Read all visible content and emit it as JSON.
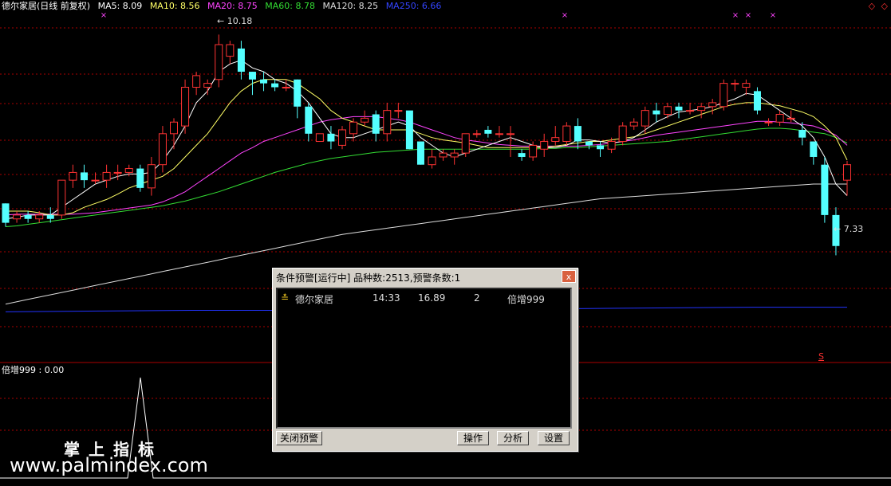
{
  "legend": {
    "stock": "德尔家居(日线 前复权)",
    "ma5": "MA5: 8.09",
    "ma10": "MA10: 8.56",
    "ma20": "MA20: 8.75",
    "ma60": "MA60: 8.78",
    "ma120": "MA120: 8.25",
    "ma250": "MA250: 6.66"
  },
  "colors": {
    "up": "#ff3333",
    "down": "#54ffff",
    "ma5": "#ffffff",
    "ma10": "#ffff66",
    "ma20": "#ff44ff",
    "ma60": "#33dd33",
    "ma120": "#dddddd",
    "ma250": "#2233ff",
    "grid": "#aa0000"
  },
  "top_right": "◇ ◇",
  "high_label": "10.18",
  "low_label": "7.33",
  "signal_mark": "S",
  "sub_legend": "倍增999 : 0.00",
  "dialog": {
    "title": "条件预警[运行中] 品种数:2513,预警条数:1",
    "close": "x",
    "row": {
      "icon": "≛",
      "name": "德尔家居",
      "time": "14:33",
      "price": "16.89",
      "count": "2",
      "formula": "倍增999"
    },
    "btn_close_alert": "关闭预警",
    "btn_operate": "操作",
    "btn_analyze": "分析",
    "btn_settings": "设置"
  },
  "watermark_cn": "掌上指标",
  "watermark_url": "www.palmindex.com",
  "chart_data": {
    "type": "candlestick",
    "ylim": [
      6.1,
      10.4
    ],
    "candles": [
      [
        8.0,
        7.75,
        7.7,
        8.0
      ],
      [
        7.8,
        7.85,
        7.75,
        7.9
      ],
      [
        7.85,
        7.8,
        7.75,
        7.9
      ],
      [
        7.8,
        7.85,
        7.75,
        7.9
      ],
      [
        7.85,
        7.8,
        7.75,
        7.95
      ],
      [
        7.85,
        8.3,
        7.8,
        8.3
      ],
      [
        8.3,
        8.4,
        8.2,
        8.5
      ],
      [
        8.4,
        8.3,
        8.2,
        8.5
      ],
      [
        8.3,
        8.3,
        8.25,
        8.4
      ],
      [
        8.3,
        8.4,
        8.2,
        8.5
      ],
      [
        8.4,
        8.4,
        8.3,
        8.5
      ],
      [
        8.4,
        8.45,
        8.35,
        8.5
      ],
      [
        8.45,
        8.2,
        8.15,
        8.5
      ],
      [
        8.2,
        8.5,
        8.1,
        8.6
      ],
      [
        8.5,
        8.9,
        8.4,
        9.0
      ],
      [
        8.9,
        9.05,
        8.7,
        9.1
      ],
      [
        9.0,
        9.5,
        8.9,
        9.6
      ],
      [
        9.5,
        9.65,
        9.4,
        9.7
      ],
      [
        9.5,
        9.55,
        9.4,
        9.6
      ],
      [
        9.6,
        10.05,
        9.5,
        10.18
      ],
      [
        9.9,
        10.05,
        9.8,
        10.1
      ],
      [
        10.0,
        9.7,
        9.6,
        10.1
      ],
      [
        9.7,
        9.6,
        9.4,
        9.7
      ],
      [
        9.6,
        9.55,
        9.45,
        9.7
      ],
      [
        9.55,
        9.5,
        9.45,
        9.6
      ],
      [
        9.5,
        9.5,
        9.45,
        9.6
      ],
      [
        9.6,
        9.25,
        9.1,
        9.6
      ],
      [
        9.25,
        8.9,
        8.8,
        9.3
      ],
      [
        8.8,
        8.9,
        8.8,
        8.9
      ],
      [
        8.9,
        8.8,
        8.7,
        9.0
      ],
      [
        8.75,
        8.95,
        8.7,
        9.0
      ],
      [
        8.9,
        9.05,
        8.8,
        9.1
      ],
      [
        9.05,
        9.1,
        9.0,
        9.2
      ],
      [
        9.15,
        8.9,
        8.8,
        9.2
      ],
      [
        8.9,
        9.2,
        8.8,
        9.3
      ],
      [
        9.2,
        9.2,
        9.1,
        9.3
      ],
      [
        9.2,
        8.7,
        8.7,
        9.0
      ],
      [
        8.8,
        8.5,
        8.5,
        8.8
      ],
      [
        8.5,
        8.6,
        8.45,
        8.7
      ],
      [
        8.6,
        8.65,
        8.55,
        8.7
      ],
      [
        8.6,
        8.65,
        8.5,
        8.7
      ],
      [
        8.65,
        8.9,
        8.6,
        8.9
      ],
      [
        8.9,
        8.9,
        8.85,
        8.95
      ],
      [
        8.95,
        8.9,
        8.85,
        9.0
      ],
      [
        8.9,
        8.9,
        8.85,
        9.0
      ],
      [
        8.9,
        8.9,
        8.6,
        9.0
      ],
      [
        8.65,
        8.6,
        8.55,
        8.7
      ],
      [
        8.6,
        8.75,
        8.55,
        8.8
      ],
      [
        8.7,
        8.8,
        8.6,
        8.9
      ],
      [
        8.8,
        8.85,
        8.75,
        9.0
      ],
      [
        8.8,
        9.0,
        8.75,
        9.05
      ],
      [
        9.0,
        8.8,
        8.7,
        9.1
      ],
      [
        8.8,
        8.75,
        8.7,
        8.8
      ],
      [
        8.75,
        8.7,
        8.6,
        8.8
      ],
      [
        8.7,
        8.8,
        8.65,
        8.85
      ],
      [
        8.8,
        9.0,
        8.75,
        9.05
      ],
      [
        9.0,
        9.05,
        8.95,
        9.1
      ],
      [
        9.0,
        9.2,
        8.9,
        9.25
      ],
      [
        9.2,
        9.15,
        9.05,
        9.3
      ],
      [
        9.15,
        9.25,
        9.1,
        9.3
      ],
      [
        9.25,
        9.2,
        9.1,
        9.3
      ],
      [
        9.2,
        9.2,
        9.15,
        9.3
      ],
      [
        9.2,
        9.25,
        9.1,
        9.3
      ],
      [
        9.25,
        9.3,
        9.15,
        9.35
      ],
      [
        9.25,
        9.55,
        9.2,
        9.6
      ],
      [
        9.55,
        9.55,
        9.45,
        9.6
      ],
      [
        9.5,
        9.55,
        9.4,
        9.6
      ],
      [
        9.45,
        9.2,
        9.15,
        9.5
      ],
      [
        9.05,
        9.05,
        9.0,
        9.1
      ],
      [
        9.05,
        9.15,
        9.0,
        9.2
      ],
      [
        9.1,
        9.1,
        9.05,
        9.2
      ],
      [
        8.95,
        8.85,
        8.75,
        9.05
      ],
      [
        8.8,
        8.6,
        8.5,
        8.8
      ],
      [
        8.5,
        7.85,
        7.75,
        8.6
      ],
      [
        7.85,
        7.45,
        7.33,
        7.95
      ],
      [
        8.3,
        8.5,
        8.1,
        8.55
      ]
    ],
    "ma5": [
      7.8,
      7.82,
      7.85,
      7.85,
      7.85,
      7.95,
      8.05,
      8.15,
      8.25,
      8.3,
      8.35,
      8.38,
      8.38,
      8.4,
      8.55,
      8.75,
      9.0,
      9.3,
      9.45,
      9.7,
      9.8,
      9.85,
      9.75,
      9.7,
      9.6,
      9.55,
      9.45,
      9.3,
      9.1,
      8.9,
      8.85,
      8.85,
      8.9,
      8.95,
      9.0,
      9.05,
      9.0,
      8.85,
      8.75,
      8.65,
      8.6,
      8.65,
      8.7,
      8.75,
      8.8,
      8.85,
      8.8,
      8.75,
      8.72,
      8.72,
      8.75,
      8.82,
      8.82,
      8.8,
      8.78,
      8.8,
      8.85,
      8.95,
      9.05,
      9.12,
      9.18,
      9.2,
      9.22,
      9.25,
      9.3,
      9.35,
      9.42,
      9.4,
      9.3,
      9.2,
      9.1,
      9.0,
      8.85,
      8.6,
      8.25,
      8.1
    ],
    "ma10": [
      7.9,
      7.9,
      7.9,
      7.88,
      7.85,
      7.85,
      7.88,
      7.95,
      8.0,
      8.05,
      8.12,
      8.2,
      8.25,
      8.3,
      8.35,
      8.45,
      8.6,
      8.75,
      8.9,
      9.1,
      9.3,
      9.45,
      9.55,
      9.6,
      9.6,
      9.6,
      9.55,
      9.45,
      9.35,
      9.2,
      9.1,
      9.05,
      9.0,
      8.95,
      8.95,
      8.95,
      8.95,
      8.9,
      8.85,
      8.82,
      8.8,
      8.78,
      8.75,
      8.72,
      8.72,
      8.72,
      8.72,
      8.72,
      8.72,
      8.74,
      8.76,
      8.78,
      8.8,
      8.8,
      8.82,
      8.84,
      8.86,
      8.9,
      8.95,
      9.0,
      9.05,
      9.1,
      9.15,
      9.2,
      9.25,
      9.28,
      9.3,
      9.3,
      9.28,
      9.26,
      9.22,
      9.18,
      9.12,
      9.0,
      8.85,
      8.56
    ],
    "ma20": [
      7.85,
      7.86,
      7.86,
      7.86,
      7.86,
      7.86,
      7.86,
      7.87,
      7.88,
      7.9,
      7.92,
      7.94,
      7.96,
      7.98,
      8.02,
      8.08,
      8.15,
      8.25,
      8.35,
      8.45,
      8.55,
      8.65,
      8.72,
      8.8,
      8.85,
      8.9,
      8.95,
      9.0,
      9.05,
      9.08,
      9.1,
      9.12,
      9.12,
      9.12,
      9.1,
      9.08,
      9.05,
      9.0,
      8.95,
      8.9,
      8.85,
      8.82,
      8.8,
      8.78,
      8.76,
      8.75,
      8.74,
      8.74,
      8.74,
      8.74,
      8.74,
      8.74,
      8.75,
      8.76,
      8.78,
      8.8,
      8.82,
      8.85,
      8.88,
      8.9,
      8.92,
      8.94,
      8.96,
      8.98,
      9.0,
      9.02,
      9.04,
      9.06,
      9.06,
      9.05,
      9.04,
      9.02,
      9.0,
      8.95,
      8.88,
      8.75
    ],
    "ma60": [
      7.7,
      7.71,
      7.73,
      7.75,
      7.77,
      7.79,
      7.81,
      7.83,
      7.85,
      7.87,
      7.89,
      7.91,
      7.93,
      7.95,
      7.97,
      8.0,
      8.03,
      8.07,
      8.11,
      8.15,
      8.2,
      8.25,
      8.3,
      8.35,
      8.4,
      8.44,
      8.48,
      8.52,
      8.55,
      8.58,
      8.6,
      8.62,
      8.64,
      8.66,
      8.67,
      8.68,
      8.69,
      8.7,
      8.7,
      8.7,
      8.7,
      8.7,
      8.7,
      8.7,
      8.7,
      8.7,
      8.7,
      8.7,
      8.71,
      8.71,
      8.72,
      8.72,
      8.73,
      8.74,
      8.75,
      8.76,
      8.77,
      8.78,
      8.79,
      8.8,
      8.82,
      8.84,
      8.86,
      8.88,
      8.9,
      8.92,
      8.94,
      8.96,
      8.97,
      8.97,
      8.96,
      8.94,
      8.92,
      8.9,
      8.85,
      8.78
    ],
    "ma120": [
      6.7,
      6.73,
      6.76,
      6.79,
      6.82,
      6.85,
      6.88,
      6.91,
      6.94,
      6.97,
      7.0,
      7.03,
      7.06,
      7.09,
      7.12,
      7.15,
      7.18,
      7.21,
      7.24,
      7.27,
      7.3,
      7.33,
      7.36,
      7.39,
      7.42,
      7.45,
      7.48,
      7.51,
      7.54,
      7.57,
      7.6,
      7.62,
      7.64,
      7.66,
      7.68,
      7.7,
      7.72,
      7.74,
      7.76,
      7.78,
      7.8,
      7.82,
      7.84,
      7.86,
      7.88,
      7.9,
      7.92,
      7.94,
      7.96,
      7.98,
      8.0,
      8.02,
      8.04,
      8.06,
      8.07,
      8.08,
      8.09,
      8.1,
      8.11,
      8.12,
      8.13,
      8.14,
      8.15,
      8.16,
      8.17,
      8.18,
      8.19,
      8.2,
      8.21,
      8.22,
      8.23,
      8.24,
      8.25,
      8.25,
      8.25,
      8.25
    ],
    "ma250": [
      6.6,
      6.61,
      6.62,
      6.62,
      6.63,
      6.64,
      6.64,
      6.65,
      6.66,
      6.66
    ]
  }
}
